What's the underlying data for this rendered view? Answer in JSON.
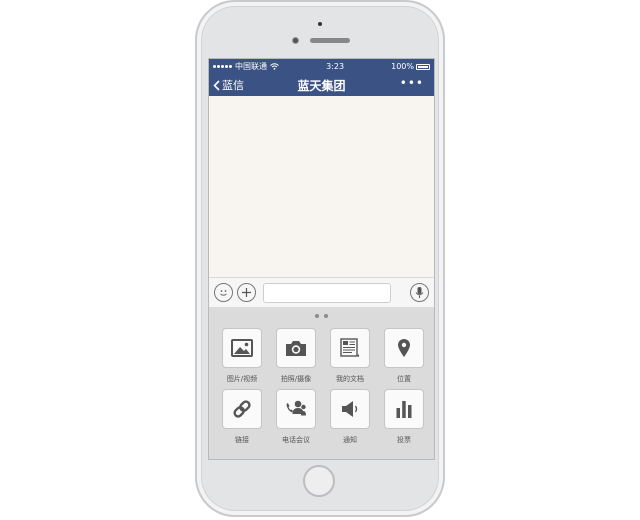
{
  "status_bar": {
    "carrier": "中国联通",
    "time": "3:23",
    "battery": "100%",
    "battery_level": 1.0
  },
  "nav": {
    "back_label": "蓝信",
    "title": "蓝天集团",
    "more": "•••"
  },
  "composer": {
    "emoji_icon": "smiley-icon",
    "add_icon": "plus-icon",
    "mic_icon": "microphone-icon",
    "input_value": ""
  },
  "panel": {
    "page_count": 2,
    "items": [
      {
        "label": "图片/视频",
        "icon": "image-icon"
      },
      {
        "label": "拍照/摄像",
        "icon": "camera-icon"
      },
      {
        "label": "我的文档",
        "icon": "document-icon"
      },
      {
        "label": "位置",
        "icon": "location-pin-icon"
      },
      {
        "label": "链接",
        "icon": "link-icon"
      },
      {
        "label": "电话会议",
        "icon": "conference-call-icon"
      },
      {
        "label": "通知",
        "icon": "speaker-icon"
      },
      {
        "label": "投票",
        "icon": "bar-chart-icon"
      }
    ]
  },
  "colors": {
    "nav_bg": "#3b5284",
    "chat_bg": "#f8f4ef",
    "panel_bg": "#dbdbdc",
    "icon": "#555555"
  }
}
